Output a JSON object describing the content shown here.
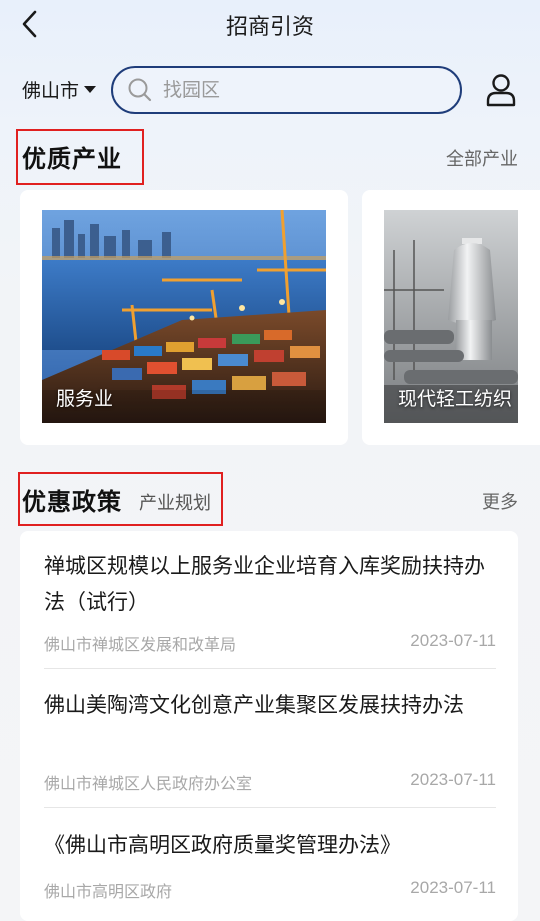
{
  "header": {
    "title": "招商引资",
    "back_icon": "chevron-left-icon"
  },
  "search_bar": {
    "city": "佛山市",
    "placeholder": "找园区",
    "search_icon": "search-icon",
    "user_icon": "user-icon"
  },
  "industries": {
    "title": "优质产业",
    "more_label": "全部产业",
    "items": [
      {
        "label": "服务业"
      },
      {
        "label": "现代轻工纺织"
      }
    ]
  },
  "policies": {
    "title": "优惠政策",
    "tab_label": "产业规划",
    "more_label": "更多",
    "items": [
      {
        "title": "禅城区规模以上服务业企业培育入库奖励扶持办法（试行）",
        "source": "佛山市禅城区发展和改革局",
        "date": "2023-07-11"
      },
      {
        "title": "佛山美陶湾文化创意产业集聚区发展扶持办法",
        "source": "佛山市禅城区人民政府办公室",
        "date": "2023-07-11"
      },
      {
        "title": "《佛山市高明区政府质量奖管理办法》",
        "source": "佛山市高明区政府",
        "date": "2023-07-11"
      }
    ]
  },
  "colors": {
    "highlight_border": "#e02020",
    "search_border": "#1f3d7a"
  }
}
